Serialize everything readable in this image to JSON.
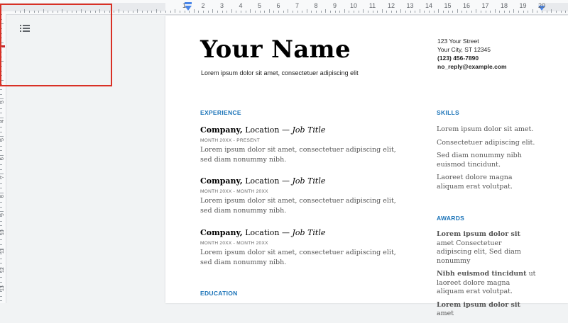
{
  "ruler": {
    "h_labels": [
      "1",
      "2",
      "3",
      "4",
      "5",
      "6",
      "7",
      "8",
      "9",
      "10",
      "11",
      "12",
      "13",
      "14",
      "15",
      "16",
      "17",
      "18",
      "19",
      "20"
    ],
    "v_labels": [
      "3",
      "4",
      "5",
      "6",
      "7",
      "8",
      "9",
      "10",
      "11",
      "12",
      "13"
    ]
  },
  "outline": {
    "icon": "list-icon"
  },
  "header": {
    "name": "Your Name",
    "tagline": "Lorem ipsum dolor sit amet, consectetuer adipiscing elit",
    "contact": {
      "street": "123 Your Street",
      "city": "Your City, ST 12345",
      "phone": "(123) 456-7890",
      "email": "no_reply@example.com"
    }
  },
  "experience": {
    "title": "EXPERIENCE",
    "jobs": [
      {
        "company": "Company,",
        "location": " Location — ",
        "role": "Job Title",
        "dates": "MONTH 20XX - PRESENT",
        "desc": "Lorem ipsum dolor sit amet, consectetuer adipiscing elit, sed diam nonummy nibh."
      },
      {
        "company": "Company,",
        "location": " Location — ",
        "role": "Job Title",
        "dates": "MONTH 20XX - MONTH 20XX",
        "desc": "Lorem ipsum dolor sit amet, consectetuer adipiscing elit, sed diam nonummy nibh."
      },
      {
        "company": "Company,",
        "location": " Location — ",
        "role": "Job Title",
        "dates": "MONTH 20XX - MONTH 20XX",
        "desc": "Lorem ipsum dolor sit amet, consectetuer adipiscing elit, sed diam nonummy nibh."
      }
    ]
  },
  "education": {
    "title": "EDUCATION"
  },
  "skills": {
    "title": "SKILLS",
    "items": [
      "Lorem ipsum dolor sit amet.",
      "Consectetuer adipiscing elit.",
      "Sed diam nonummy nibh euismod tincidunt.",
      "Laoreet dolore magna aliquam erat volutpat."
    ]
  },
  "awards": {
    "title": "AWARDS",
    "items": [
      {
        "bold": "Lorem ipsum dolor sit",
        "rest": " amet Consectetuer adipiscing elit, Sed diam nonummy"
      },
      {
        "bold": "Nibh euismod tincidunt",
        "rest": " ut laoreet dolore magna aliquam erat volutpat."
      },
      {
        "bold": "Lorem ipsum dolor sit",
        "rest": " amet"
      }
    ]
  },
  "colors": {
    "accent": "#1a73b8",
    "highlight": "#d93025",
    "indent": "#4a86e8"
  }
}
